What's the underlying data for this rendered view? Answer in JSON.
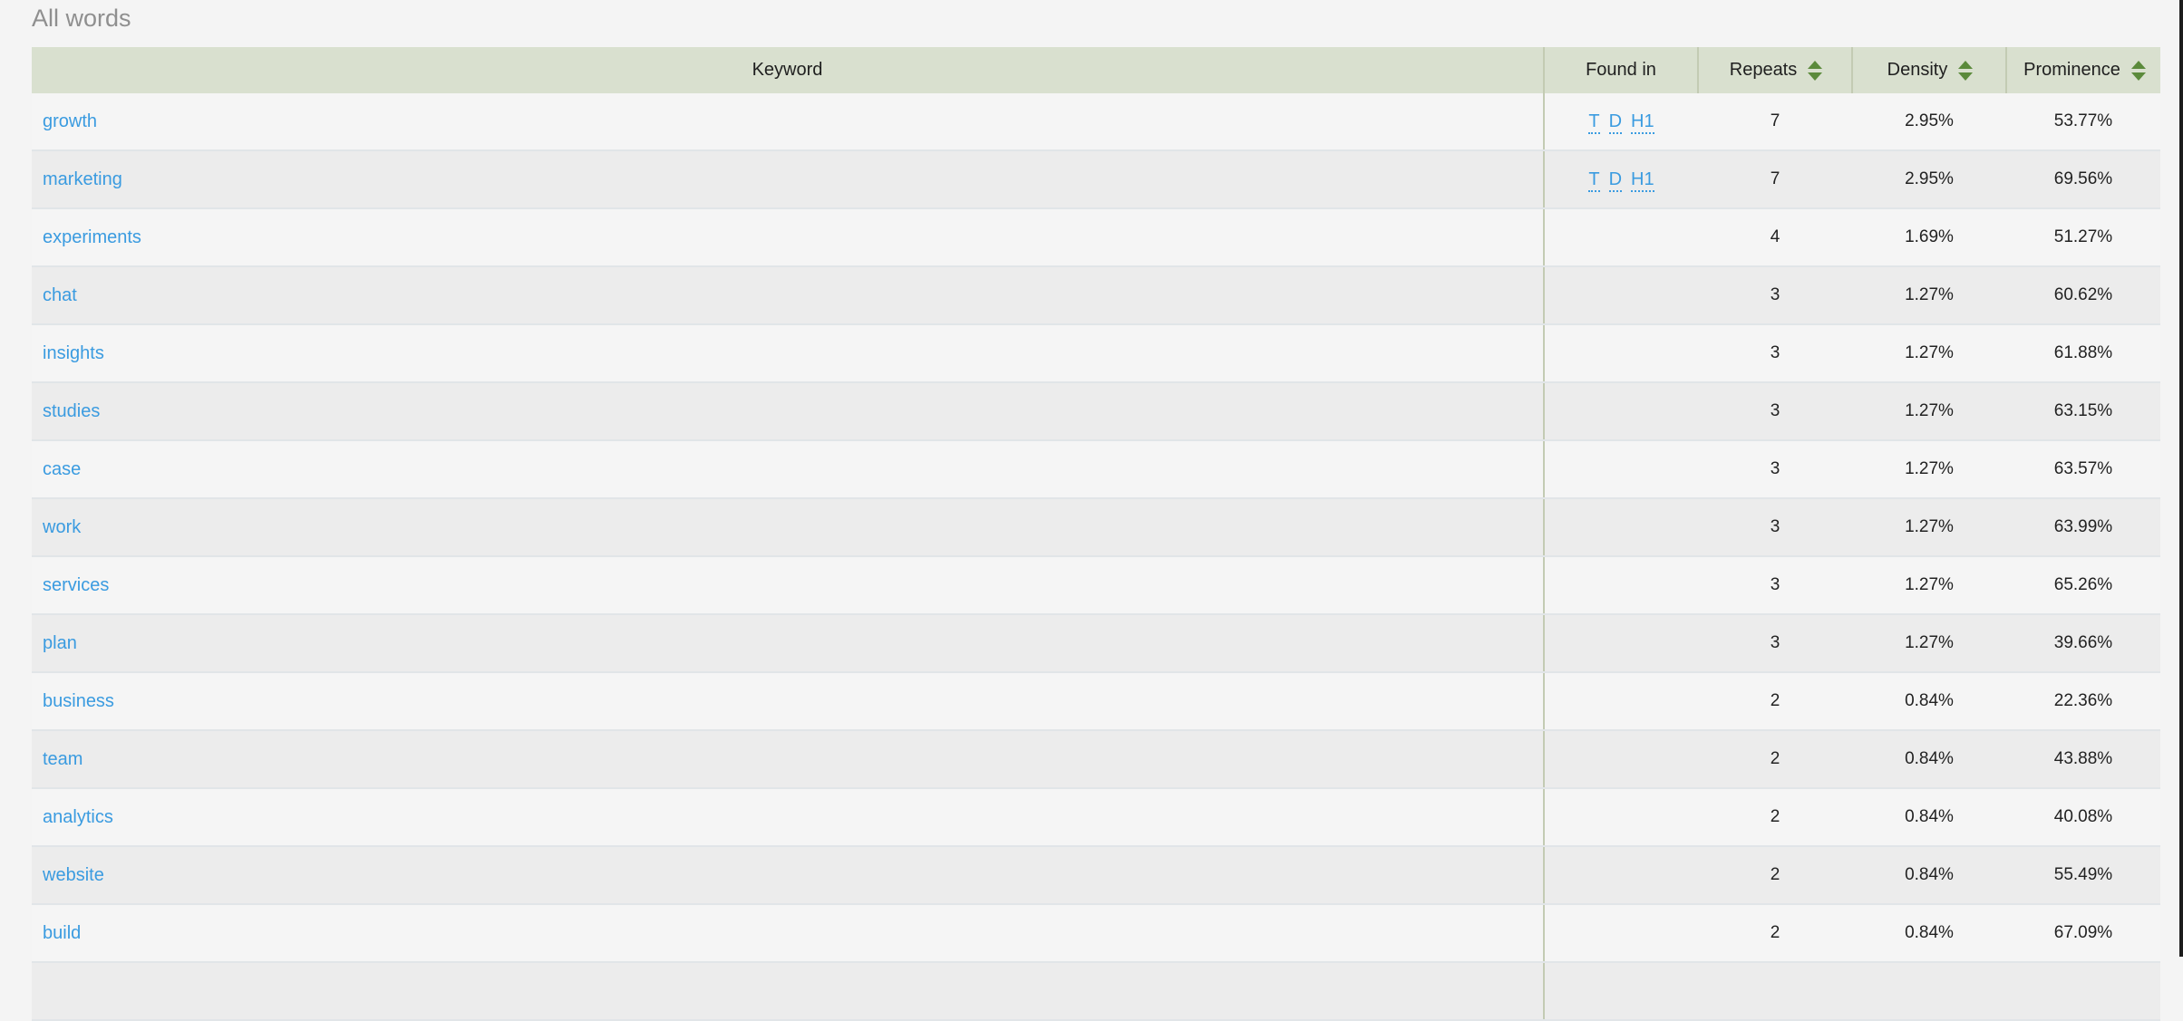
{
  "section": {
    "title": "All words"
  },
  "colors": {
    "header_bg": "#d9e0cf",
    "link": "#3a9be0",
    "sort_icon": "#5b8a3b"
  },
  "table": {
    "headers": {
      "keyword": "Keyword",
      "found_in": "Found in",
      "repeats": "Repeats",
      "density": "Density",
      "prominence": "Prominence"
    },
    "rows": [
      {
        "keyword": "growth",
        "found_in": [
          "T",
          "D",
          "H1"
        ],
        "repeats": "7",
        "density": "2.95%",
        "prominence": "53.77%"
      },
      {
        "keyword": "marketing",
        "found_in": [
          "T",
          "D",
          "H1"
        ],
        "repeats": "7",
        "density": "2.95%",
        "prominence": "69.56%"
      },
      {
        "keyword": "experiments",
        "found_in": [],
        "repeats": "4",
        "density": "1.69%",
        "prominence": "51.27%"
      },
      {
        "keyword": "chat",
        "found_in": [],
        "repeats": "3",
        "density": "1.27%",
        "prominence": "60.62%"
      },
      {
        "keyword": "insights",
        "found_in": [],
        "repeats": "3",
        "density": "1.27%",
        "prominence": "61.88%"
      },
      {
        "keyword": "studies",
        "found_in": [],
        "repeats": "3",
        "density": "1.27%",
        "prominence": "63.15%"
      },
      {
        "keyword": "case",
        "found_in": [],
        "repeats": "3",
        "density": "1.27%",
        "prominence": "63.57%"
      },
      {
        "keyword": "work",
        "found_in": [],
        "repeats": "3",
        "density": "1.27%",
        "prominence": "63.99%"
      },
      {
        "keyword": "services",
        "found_in": [],
        "repeats": "3",
        "density": "1.27%",
        "prominence": "65.26%"
      },
      {
        "keyword": "plan",
        "found_in": [],
        "repeats": "3",
        "density": "1.27%",
        "prominence": "39.66%"
      },
      {
        "keyword": "business",
        "found_in": [],
        "repeats": "2",
        "density": "0.84%",
        "prominence": "22.36%"
      },
      {
        "keyword": "team",
        "found_in": [],
        "repeats": "2",
        "density": "0.84%",
        "prominence": "43.88%"
      },
      {
        "keyword": "analytics",
        "found_in": [],
        "repeats": "2",
        "density": "0.84%",
        "prominence": "40.08%"
      },
      {
        "keyword": "website",
        "found_in": [],
        "repeats": "2",
        "density": "0.84%",
        "prominence": "55.49%"
      },
      {
        "keyword": "build",
        "found_in": [],
        "repeats": "2",
        "density": "0.84%",
        "prominence": "67.09%"
      },
      {
        "keyword": "",
        "found_in": [],
        "repeats": "",
        "density": "",
        "prominence": ""
      }
    ]
  }
}
